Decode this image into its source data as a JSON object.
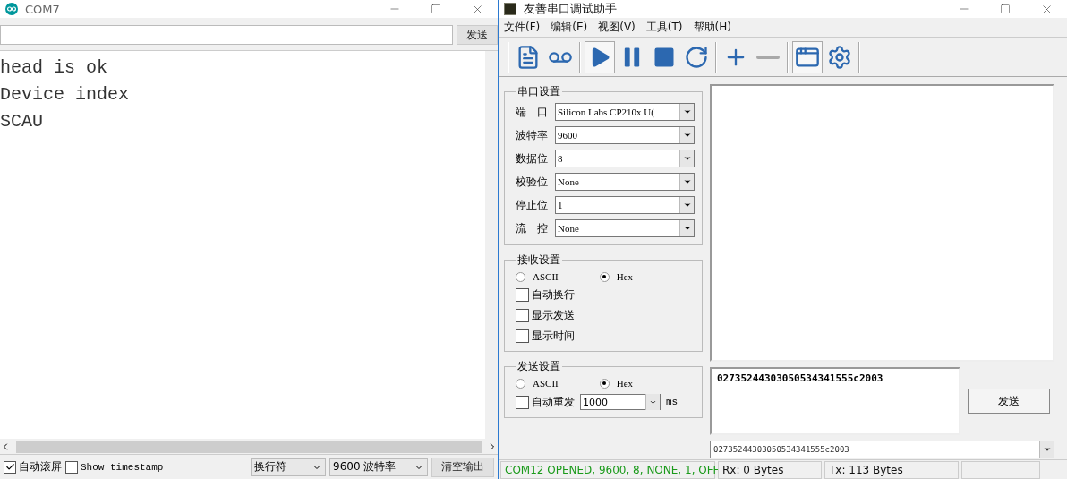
{
  "left_window": {
    "title": "COM7",
    "send_button": "发送",
    "output_lines": [
      "head is ok",
      "Device index",
      "SCAU"
    ],
    "autoscroll": {
      "label": "自动滚屏",
      "checked": true
    },
    "timestamp": {
      "label": "Show timestamp",
      "checked": false
    },
    "line_ending": "换行符",
    "baud": "9600 波特率",
    "clear_button": "清空输出"
  },
  "right_window": {
    "title": "友善串口调试助手",
    "menu": [
      "文件(F)",
      "编辑(E)",
      "视图(V)",
      "工具(T)",
      "帮助(H)"
    ],
    "toolbar": [
      {
        "kind": "file",
        "pressed": false
      },
      {
        "kind": "record",
        "pressed": false
      },
      {
        "kind": "play",
        "pressed": true
      },
      {
        "kind": "pause",
        "pressed": false
      },
      {
        "kind": "stop",
        "pressed": false
      },
      {
        "kind": "refresh",
        "pressed": false
      },
      {
        "kind": "add",
        "pressed": false
      },
      {
        "kind": "remove",
        "pressed": false
      },
      {
        "kind": "window",
        "pressed": true
      },
      {
        "kind": "settings",
        "pressed": false
      }
    ],
    "serial_settings": {
      "title": "串口设置",
      "fields": [
        {
          "label": "端　口",
          "value": "Silicon Labs CP210x U("
        },
        {
          "label": "波特率",
          "value": "9600"
        },
        {
          "label": "数据位",
          "value": "8"
        },
        {
          "label": "校验位",
          "value": "None"
        },
        {
          "label": "停止位",
          "value": "1"
        },
        {
          "label": "流　控",
          "value": "None"
        }
      ]
    },
    "receive_settings": {
      "title": "接收设置",
      "modes": [
        {
          "label": "ASCII",
          "selected": false
        },
        {
          "label": "Hex",
          "selected": true
        }
      ],
      "options": [
        {
          "label": "自动换行",
          "checked": false
        },
        {
          "label": "显示发送",
          "checked": false
        },
        {
          "label": "显示时间",
          "checked": false
        }
      ]
    },
    "send_settings": {
      "title": "发送设置",
      "modes": [
        {
          "label": "ASCII",
          "selected": false
        },
        {
          "label": "Hex",
          "selected": true
        }
      ],
      "auto_resend": {
        "label": "自动重发",
        "checked": false
      },
      "interval": "1000",
      "unit": "ms"
    },
    "send_text": "02735244303050534341555c2003",
    "send_button": "发送",
    "history": "02735244303050534341555c2003",
    "status": [
      "COM12 OPENED, 9600, 8, NONE, 1, OFF",
      "Rx: 0 Bytes",
      "Tx: 113 Bytes"
    ]
  }
}
